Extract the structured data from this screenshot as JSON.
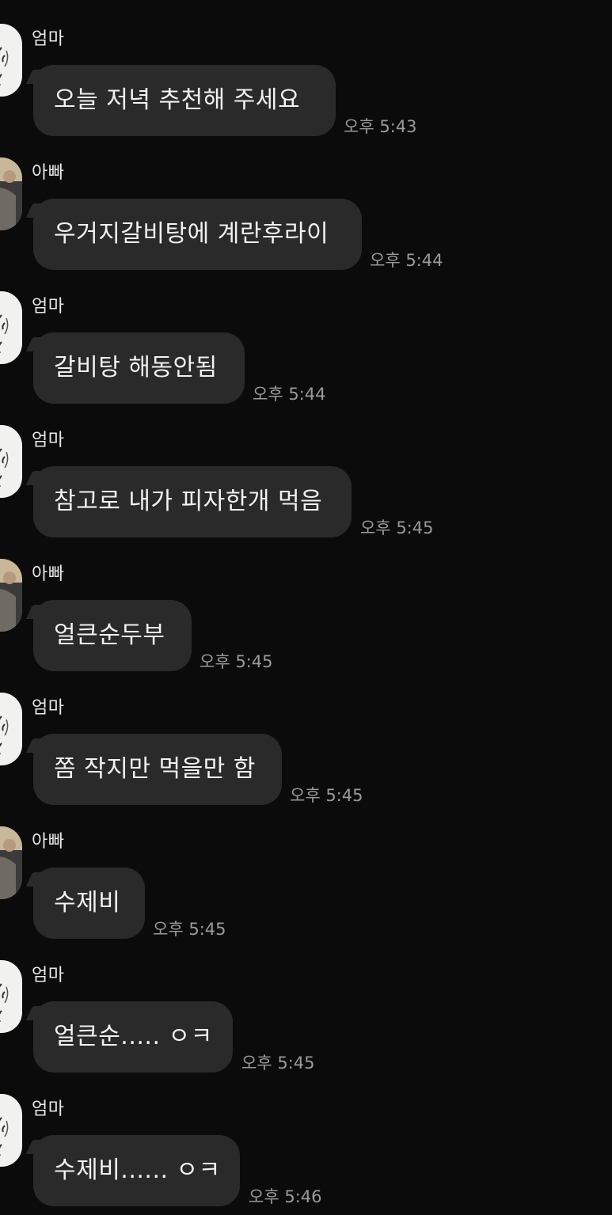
{
  "messages": [
    {
      "sender": "엄마",
      "avatar": "mom-avatar",
      "text": "오늘 저녁 추천해 주세요",
      "time": "오후 5:43"
    },
    {
      "sender": "아빠",
      "avatar": "dad-avatar",
      "text": "우거지갈비탕에 계란후라이",
      "time": "오후 5:44"
    },
    {
      "sender": "엄마",
      "avatar": "mom-avatar",
      "text": "갈비탕 해동안됨",
      "time": "오후 5:44"
    },
    {
      "sender": "엄마",
      "avatar": "mom-avatar",
      "text": "참고로 내가 피자한개 먹음",
      "time": "오후 5:45"
    },
    {
      "sender": "아빠",
      "avatar": "dad-avatar",
      "text": "얼큰순두부",
      "time": "오후 5:45"
    },
    {
      "sender": "엄마",
      "avatar": "mom-avatar",
      "text": "쫌 작지만 먹을만 함",
      "time": "오후 5:45"
    },
    {
      "sender": "아빠",
      "avatar": "dad-avatar",
      "text": "수제비",
      "time": "오후 5:45"
    },
    {
      "sender": "엄마",
      "avatar": "mom-avatar",
      "text": "얼큰순..... ㅇㅋ",
      "time": "오후 5:45"
    },
    {
      "sender": "엄마",
      "avatar": "mom-avatar",
      "text": "수제비...... ㅇㅋ",
      "time": "오후 5:46"
    }
  ],
  "colors": {
    "background": "#0b0b0b",
    "bubble": "#2a2a2a",
    "text": "#f2f2f2",
    "timestamp": "#9a9a9a"
  }
}
